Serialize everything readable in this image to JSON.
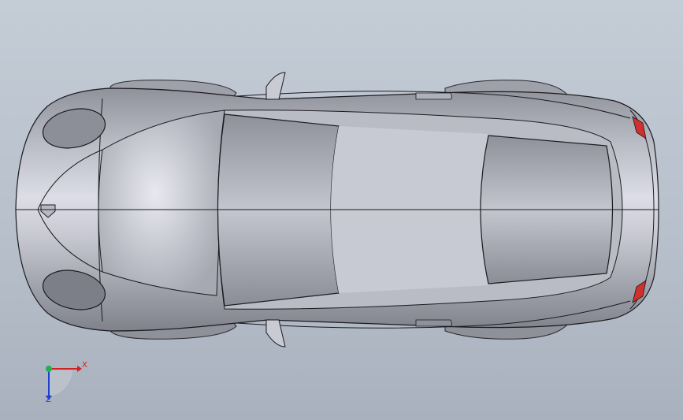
{
  "view": {
    "background_top": "#c4ccd6",
    "background_bottom": "#a8b1bd",
    "model_color": "#9a9ca6",
    "tail_light_color": "#d0312d",
    "edge_color": "#1b1b1f"
  },
  "triad": {
    "x_label": "X",
    "z_label": "Z",
    "x_color": "#d21f1f",
    "y_color": "#1fb34a",
    "z_color": "#1f3fd2"
  }
}
